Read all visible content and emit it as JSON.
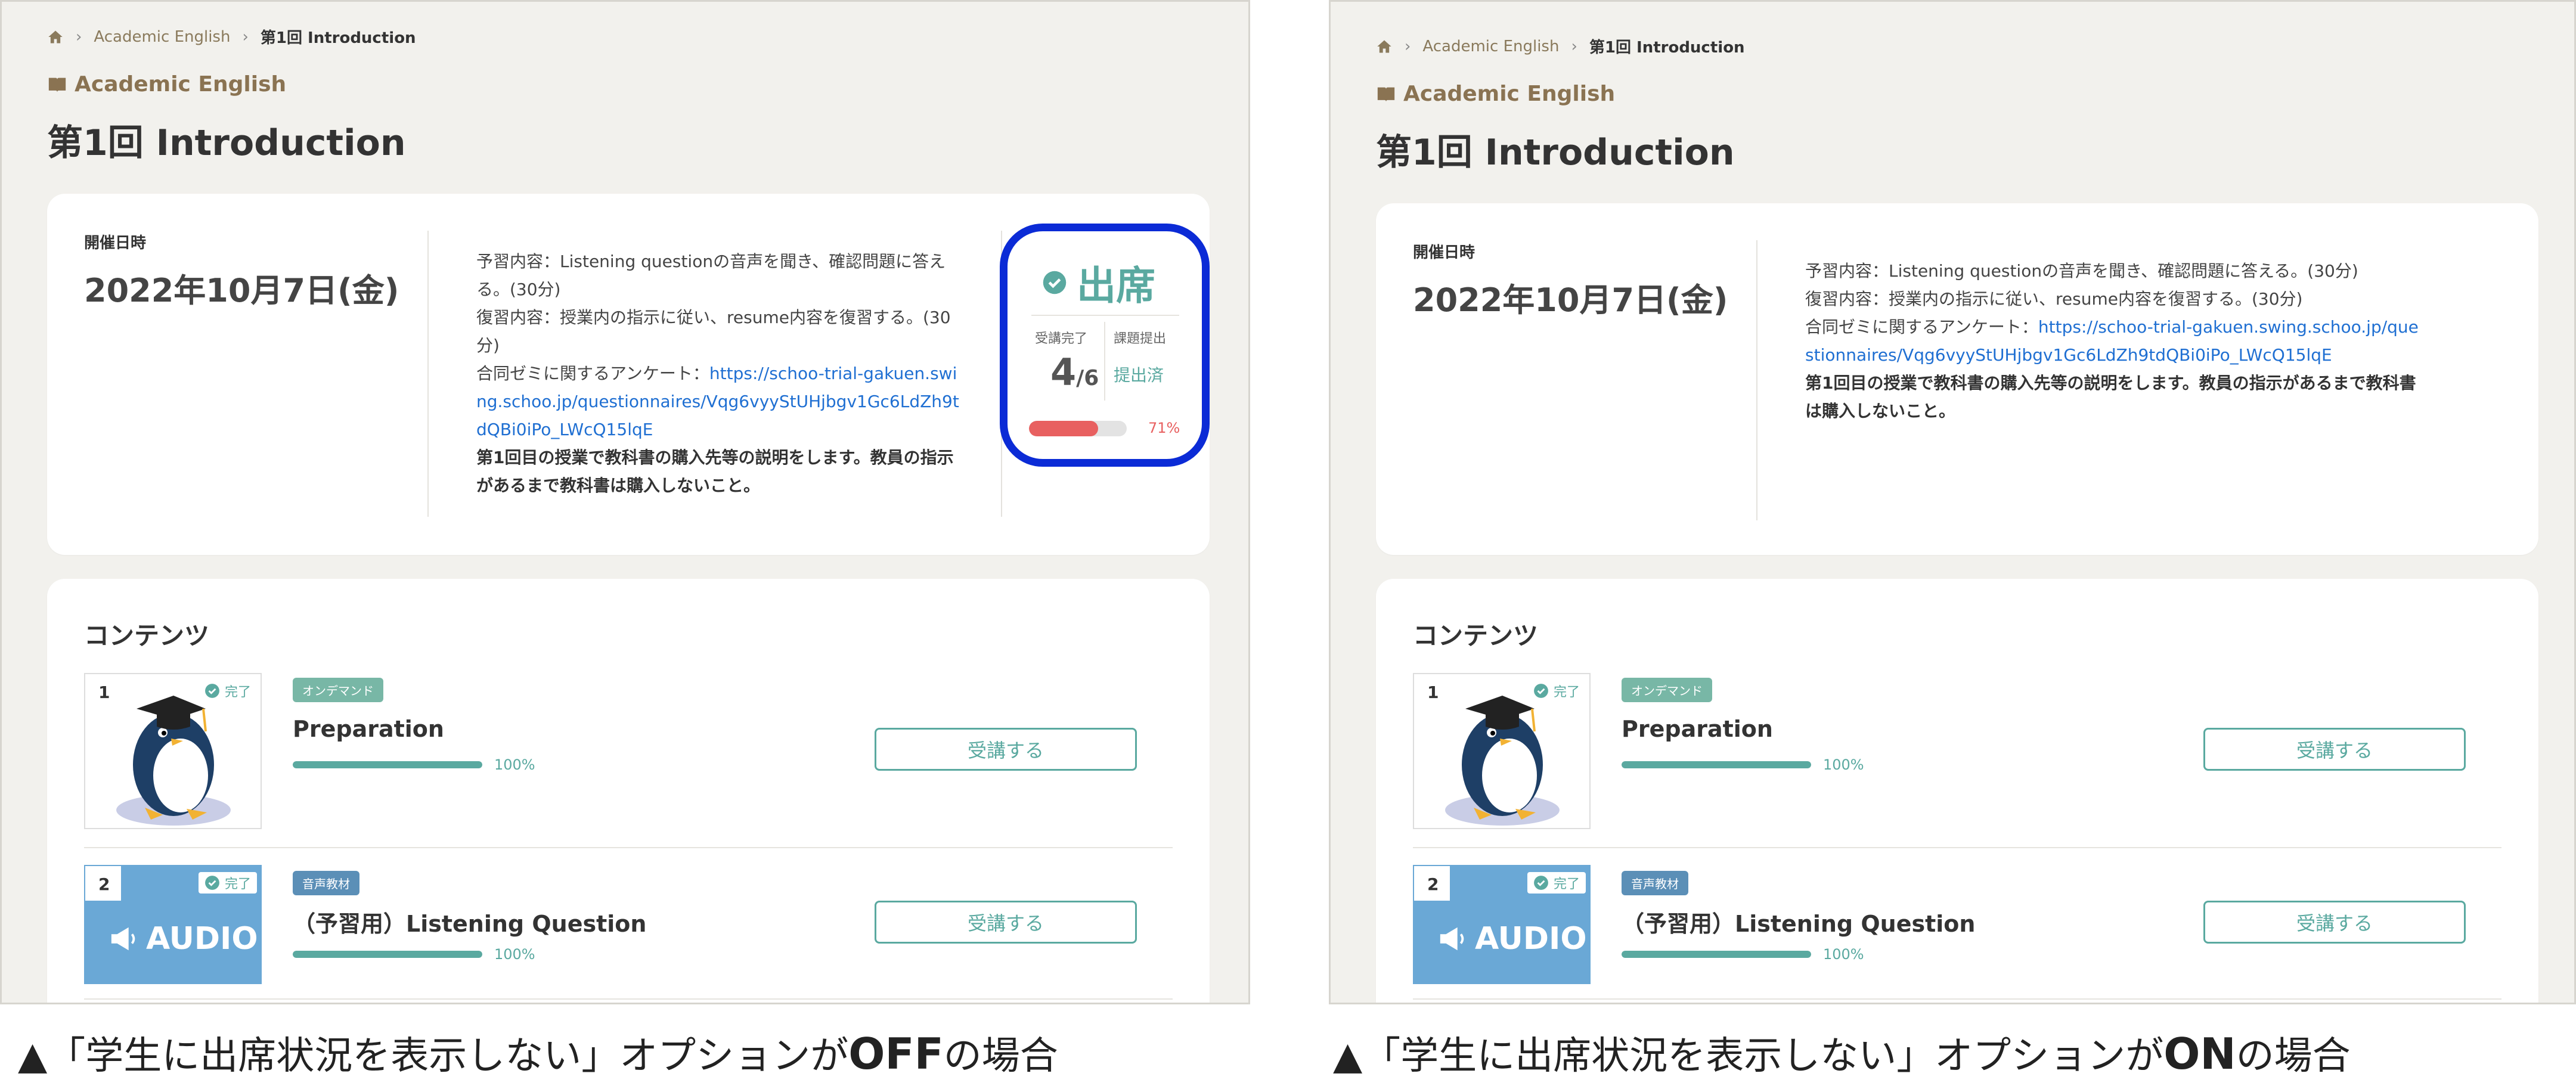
{
  "breadcrumb": {
    "course": "Academic English",
    "current": "第1回 Introduction"
  },
  "course_label": "Academic English",
  "page_title": "第1回 Introduction",
  "schedule": {
    "label": "開催日時",
    "date": "2022年10月7日(金)"
  },
  "description": {
    "line1": "予習内容：Listening questionの音声を聞き、確認問題に答える。(30分)",
    "line2": "復習内容：授業内の指示に従い、resume内容を復習する。(30分)",
    "line3_prefix": "合同ゼミに関するアンケート：",
    "link": "https://schoo-trial-gakuen.swing.schoo.jp/questionnaires/Vqg6vyyStUHjbgv1Gc6LdZh9tdQBi0iPo_LWcQ15lqE",
    "note": "第1回目の授業で教科書の購入先等の説明をします。教員の指示があるまで教科書は購入しないこと。"
  },
  "attendance": {
    "status": "出席",
    "completed_label": "受講完了",
    "assignment_label": "課題提出",
    "completed_num": "4",
    "completed_den": "/6",
    "assignment_status": "提出済",
    "rate": 0.71,
    "rate_label": "71%"
  },
  "contents": {
    "title": "コンテンツ",
    "items": [
      {
        "number": "1",
        "done": "完了",
        "tag": "オンデマンド",
        "title": "Preparation",
        "progress": 1.0,
        "progress_label": "100%",
        "button": "受講する"
      },
      {
        "number": "2",
        "done": "完了",
        "tag": "音声教材",
        "title": "（予習用）Listening Question",
        "progress": 1.0,
        "progress_label": "100%",
        "button": "受講する",
        "thumb_label": "AUDIO"
      }
    ]
  },
  "captions": {
    "left_prefix": "▲「学生に出席状況を表示しない」オプションが",
    "left_strong": "OFF",
    "left_suffix": "の場合",
    "right_prefix": "▲「学生に出席状況を表示しない」オプションが",
    "right_strong": "ON",
    "right_suffix": "の場合"
  },
  "colors": {
    "accent": "#5aa9a0",
    "highlight": "#0b2bd6",
    "rate": "#e86060",
    "link": "#1f6fd2",
    "brown": "#8a7352"
  },
  "icons": {
    "home": "home-icon",
    "book": "book-icon",
    "check": "check-circle-icon",
    "megaphone": "megaphone-icon",
    "chevron": "chevron-right-icon"
  }
}
